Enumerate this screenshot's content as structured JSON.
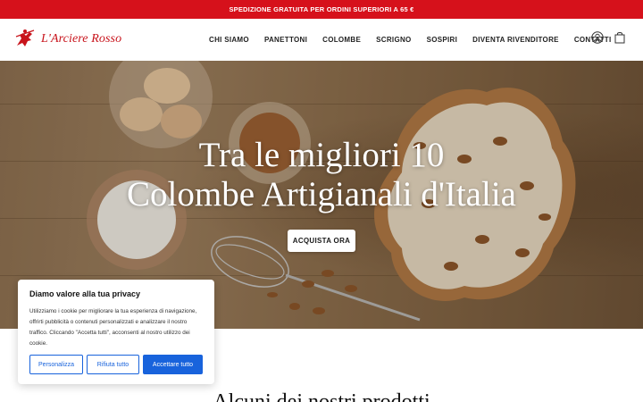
{
  "topbar": {
    "text": "SPEDIZIONE GRATUITA PER ORDINI SUPERIORI A 65 €"
  },
  "brand": {
    "name": "L'Arciere Rosso",
    "color": "#c8141c"
  },
  "nav": {
    "items": [
      "CHI SIAMO",
      "PANETTONI",
      "COLOMBE",
      "SCRIGNO",
      "SOSPIRI",
      "DIVENTA RIVENDITORE",
      "CONTATTI"
    ]
  },
  "header_icons": [
    "user-icon",
    "shopping-bag-icon"
  ],
  "hero": {
    "title_line1": "Tra le migliori 10",
    "title_line2": "Colombe Artigianali d'Italia",
    "button": "ACQUISTA ORA"
  },
  "cookie": {
    "title": "Diamo valore alla tua privacy",
    "text": "Utilizziamo i cookie per migliorare la tua esperienza di navigazione, offrirti pubblicità o contenuti personalizzati e analizzare il nostro traffico. Cliccando \"Accetta tutti\", acconsenti al nostro utilizzo dei cookie.",
    "btn_customize": "Personalizza",
    "btn_reject": "Rifiuta tutto",
    "btn_accept": "Accettare tutto",
    "accent": "#1863dc"
  },
  "section": {
    "title": "Alcuni dei nostri prodotti"
  },
  "colors": {
    "topbar": "#d6111b"
  }
}
